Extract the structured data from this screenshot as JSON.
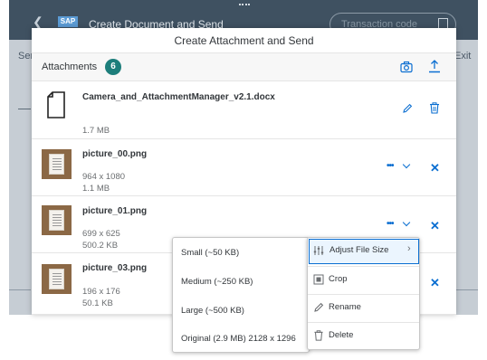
{
  "background": {
    "app_title": "Create Document and Send",
    "search_placeholder": "Transaction code",
    "left_text": "Sen",
    "right_text": "Exit"
  },
  "dialog": {
    "title": "Create Attachment and Send"
  },
  "toolbar": {
    "title": "Attachments",
    "count": "6"
  },
  "attachments": [
    {
      "name": "Camera_and_AttachmentManager_v2.1.docx",
      "size": "1.7 MB",
      "icon": "document-icon"
    },
    {
      "name": "picture_00.png",
      "dimensions": "964 x 1080",
      "size": "1.1 MB",
      "icon": "image-thumbnail"
    },
    {
      "name": "picture_01.png",
      "dimensions": "699 x 625",
      "size": "500.2 KB",
      "icon": "image-thumbnail"
    },
    {
      "name": "picture_03.png",
      "dimensions": "196 x 176",
      "size": "50.1 KB",
      "icon": "image-thumbnail"
    }
  ],
  "action_menu": {
    "items": [
      {
        "label": "Adjust File Size",
        "icon": "adjust-icon"
      },
      {
        "label": "Crop",
        "icon": "crop-icon"
      },
      {
        "label": "Rename",
        "icon": "edit-icon"
      },
      {
        "label": "Delete",
        "icon": "trash-icon"
      }
    ]
  },
  "size_menu": {
    "options": [
      "Small (~50 KB)",
      "Medium (~250 KB)",
      "Large (~500 KB)",
      "Original (2.9 MB) 2128 x 1296"
    ]
  },
  "colors": {
    "accent": "#0a6ed1",
    "badge": "#1d7e7b",
    "shell": "#3f5161"
  }
}
